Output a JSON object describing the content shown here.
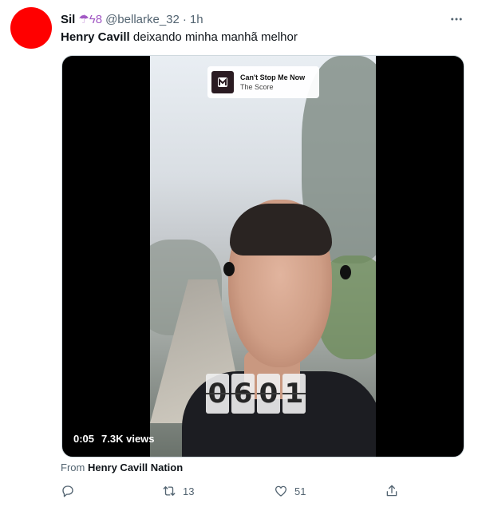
{
  "author": {
    "display_name": "Sil",
    "emoji": "☂ϟ8",
    "handle": "@bellarke_32",
    "separator": "·",
    "time": "1h",
    "avatar_color": "#ff0000"
  },
  "tweet": {
    "mention_name": "Henry Cavill",
    "text": " deixando minha manhã melhor"
  },
  "media": {
    "music_title": "Can't Stop Me Now",
    "music_artist": "The Score",
    "counter_digits": [
      "0",
      "6",
      "0",
      "1"
    ],
    "duration": "0:05",
    "views": "7.3K views"
  },
  "attribution": {
    "prefix": "From",
    "source": "Henry Cavill Nation"
  },
  "actions": {
    "retweet_count": "13",
    "like_count": "51"
  },
  "icons": {
    "more": "more-horizontal-icon",
    "reply": "reply-icon",
    "retweet": "retweet-icon",
    "like": "heart-icon",
    "share": "share-icon",
    "music_logo": "music-app-logo"
  }
}
